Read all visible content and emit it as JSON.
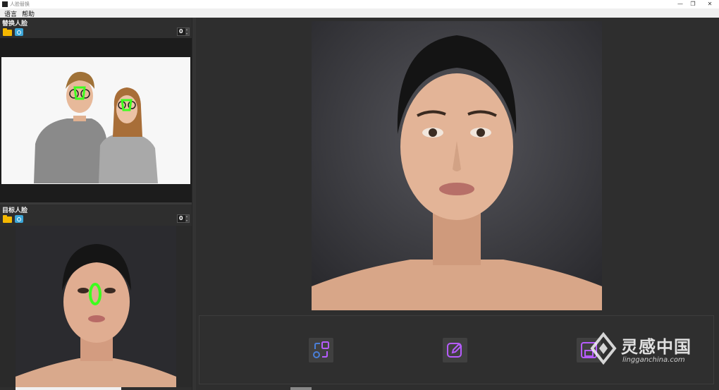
{
  "window": {
    "title": "人脸替换",
    "controls": [
      "—",
      "❐",
      "✕"
    ]
  },
  "menu": {
    "items": [
      "语言",
      "帮助"
    ]
  },
  "source_panel": {
    "label": "替换人脸",
    "index_value": "0"
  },
  "target_panel": {
    "label": "目标人脸",
    "index_value": "0"
  },
  "actions": {
    "swap_icon": "swap-faces-icon",
    "edit_icon": "edit-icon",
    "save_icon": "save-icon"
  },
  "watermark": {
    "title": "灵感中国",
    "url": "lingganchina.com"
  },
  "colors": {
    "background": "#2e2e2e",
    "landmark_green": "#3cff1e",
    "accent_purple": "#b65cff",
    "accent_blue": "#4a7fd8"
  }
}
